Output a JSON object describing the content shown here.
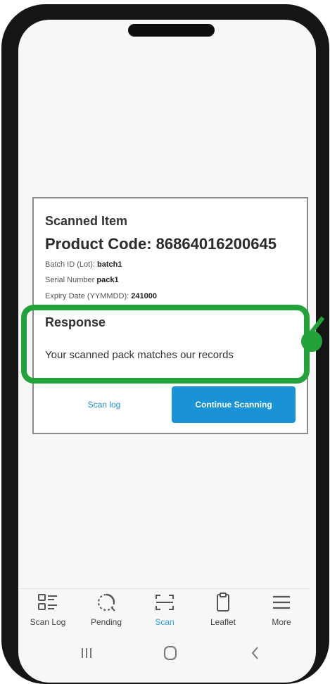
{
  "scan_result": {
    "title": "Scanned Item",
    "product_code_label": "Product Code: 86864016200645",
    "batch_label": "Batch ID (Lot):",
    "batch_value": "batch1",
    "serial_label": "Serial Number",
    "serial_value": "pack1",
    "expiry_label": "Expiry Date (YYMMDD):",
    "expiry_value": "241000",
    "response_title": "Response",
    "response_message": "Your scanned pack matches our records"
  },
  "actions": {
    "scan_log_label": "Scan log",
    "continue_label": "Continue Scanning"
  },
  "colors": {
    "highlight": "#22a33a",
    "primary_button": "#1a93d6",
    "active_tab": "#2aa4dc"
  },
  "bottom_nav": {
    "items": [
      {
        "label": "Scan Log",
        "icon": "scan-log-icon"
      },
      {
        "label": "Pending",
        "icon": "pending-icon"
      },
      {
        "label": "Scan",
        "icon": "scan-icon",
        "active": true
      },
      {
        "label": "Leaflet",
        "icon": "leaflet-icon"
      },
      {
        "label": "More",
        "icon": "menu-icon"
      }
    ]
  },
  "system_nav": [
    "recent-apps-icon",
    "home-icon",
    "back-icon"
  ]
}
